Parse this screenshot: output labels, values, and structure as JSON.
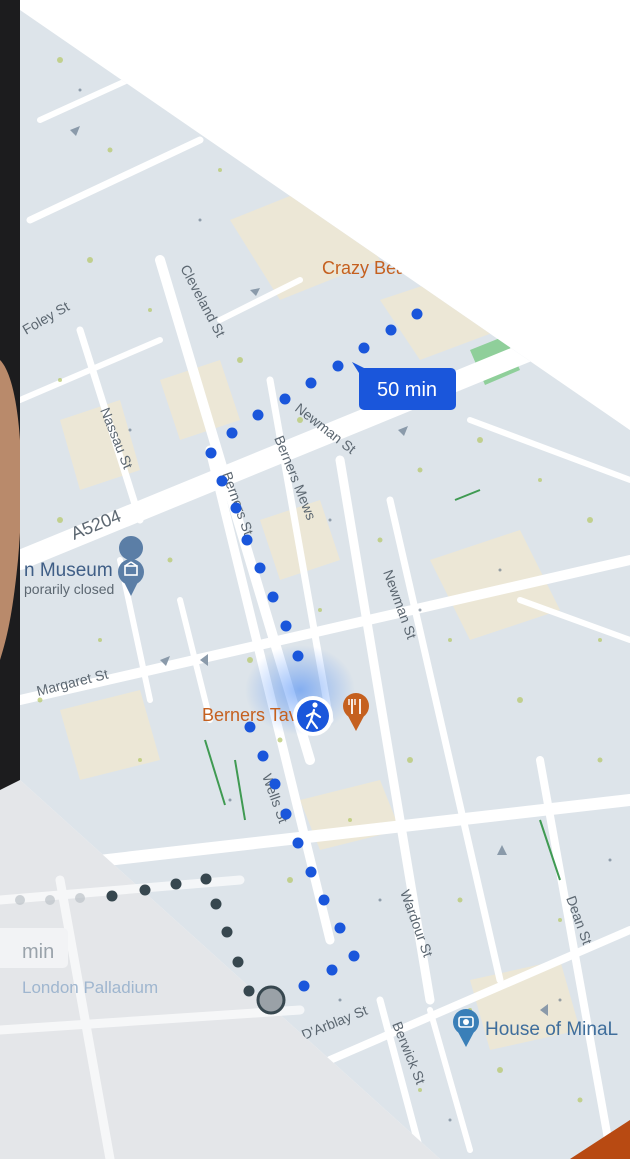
{
  "route": {
    "duration_label": "50 min",
    "mode": "walking",
    "secondary_duration_label": "min",
    "color": "#1a56db",
    "secondary_color": "#37474f"
  },
  "streets": {
    "cleveland": "Cleveland St",
    "foley": "Foley St",
    "nassau": "Nassau St",
    "a5204": "A5204",
    "newman_upper": "Newman St",
    "newman_lower": "Newman St",
    "berners": "Berners St",
    "berners_mews": "Berners Mews",
    "margaret": "Margaret St",
    "wells": "Wells St",
    "wardour": "Wardour St",
    "dean": "Dean St",
    "darblay": "D'Arblay St",
    "berwick": "Berwick St"
  },
  "places": {
    "crazy": "Crazy Bear",
    "museum_name": "n Museum",
    "museum_status": "porarily closed",
    "berners_tavern": "Berners Tavern",
    "palladium": "London Palladium",
    "house_of_mina": "House of MinaL"
  },
  "icons": {
    "museum": "museum-pin-icon",
    "restaurant": "restaurant-pin-icon",
    "walking": "walking-person-icon",
    "camera": "camera-pin-icon"
  },
  "colors": {
    "land": "#dde4ea",
    "roads": "#ffffff",
    "built": "#ece7d6",
    "park": "#8fcf9a",
    "text": "#5c6771",
    "poi_orange": "#c5601f",
    "poi_blue": "#3a7fb8"
  }
}
